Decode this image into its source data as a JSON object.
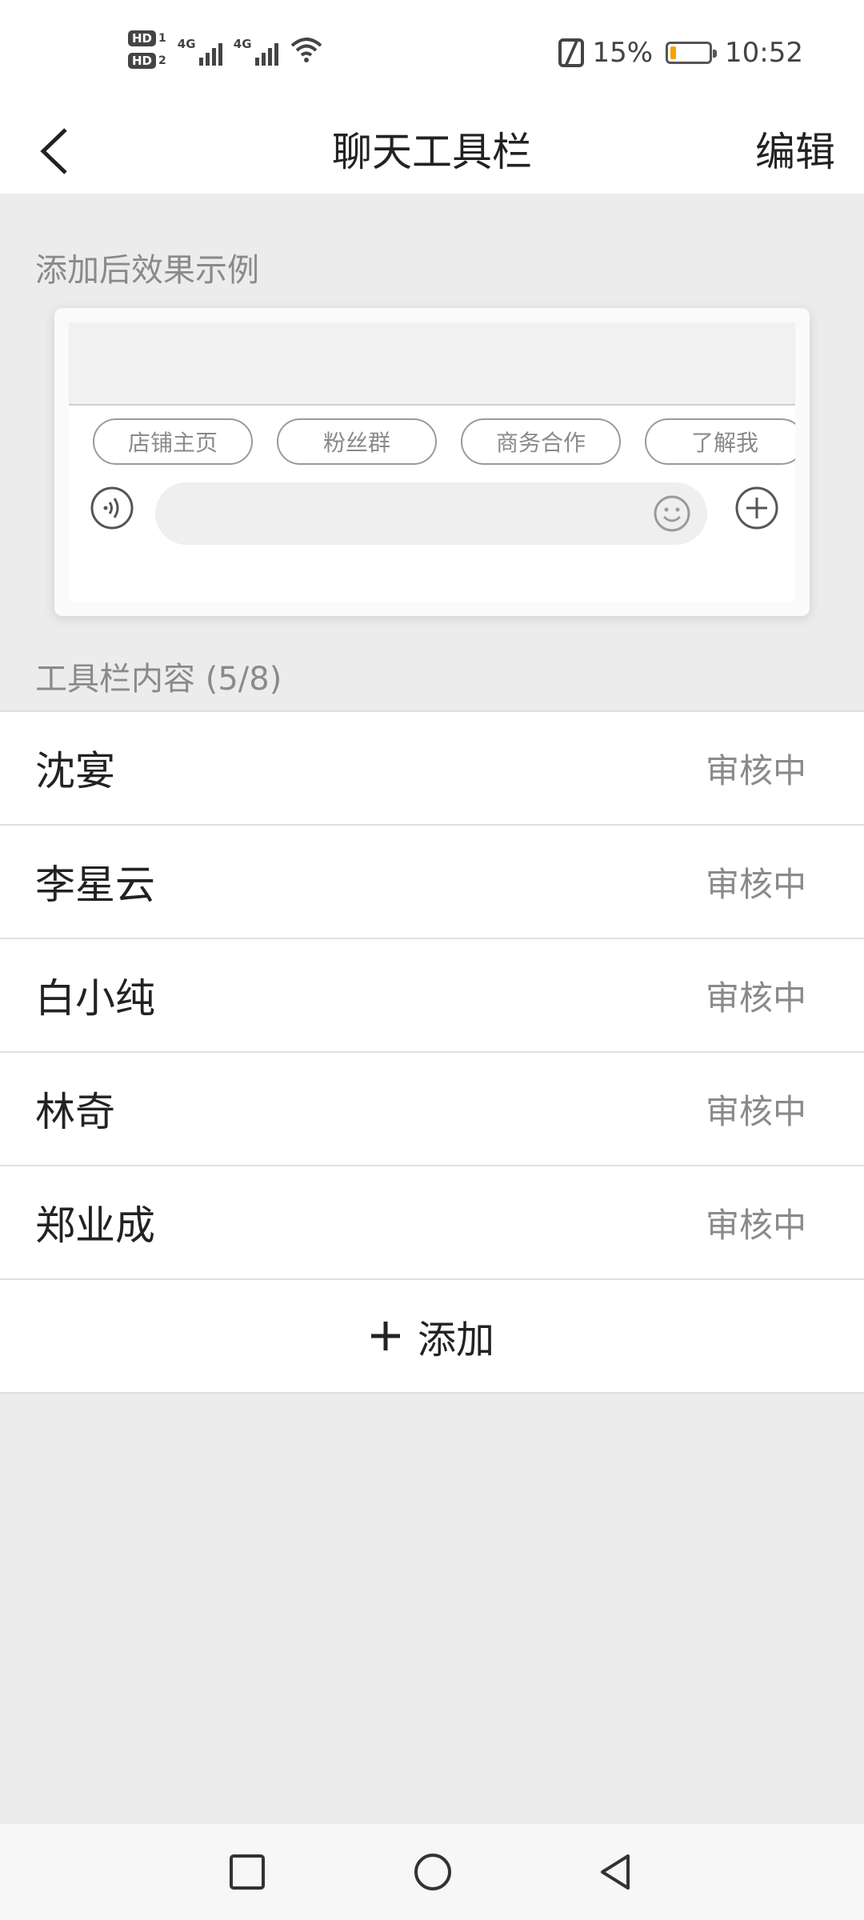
{
  "status_bar": {
    "sim1_badge": "HD",
    "sim1_slot": "1",
    "sim2_badge": "HD",
    "sim2_slot": "2",
    "net1": "4G",
    "net2": "4G",
    "battery_percent": "15%",
    "battery_level": 0.15,
    "time": "10:52",
    "icons": [
      "signal-icon",
      "wifi-icon",
      "nfc-icon",
      "battery-icon"
    ],
    "battery_fill_color": "#f5a200"
  },
  "header": {
    "title": "聊天工具栏",
    "edit_label": "编辑"
  },
  "preview": {
    "section_label": "添加后效果示例",
    "chips": [
      "店铺主页",
      "粉丝群",
      "商务合作",
      "了解我",
      ""
    ]
  },
  "toolbar": {
    "section_label": "工具栏内容 (5/8)",
    "items": [
      {
        "name": "沈宴",
        "status": "审核中"
      },
      {
        "name": "李星云",
        "status": "审核中"
      },
      {
        "name": "白小纯",
        "status": "审核中"
      },
      {
        "name": "林奇",
        "status": "审核中"
      },
      {
        "name": "郑业成",
        "status": "审核中"
      }
    ],
    "add_label": "添加"
  },
  "colors": {
    "page_background": "#ececec",
    "secondary_text": "#8a8a8a",
    "primary_text": "#222222"
  }
}
